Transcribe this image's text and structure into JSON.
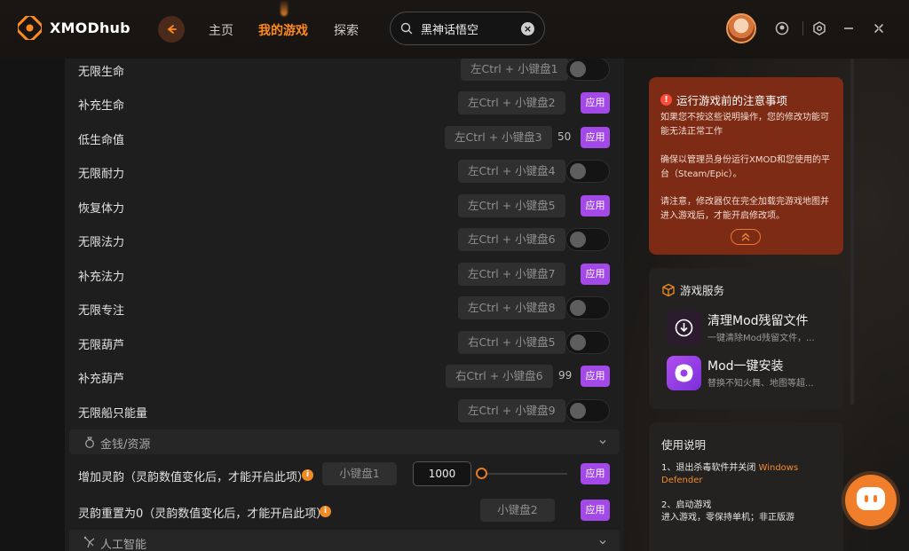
{
  "app": {
    "logo_main": "XMODhub",
    "nav": [
      {
        "label": "主页",
        "active": false
      },
      {
        "label": "我的游戏",
        "active": true
      },
      {
        "label": "探索",
        "active": false
      }
    ],
    "search": {
      "value": "黑神话悟空",
      "clear_glyph": "×"
    }
  },
  "cheats": [
    {
      "label": "无限生命",
      "hotkey": "左Ctrl + 小键盘1",
      "control": "toggle",
      "state": "off"
    },
    {
      "label": "补充生命",
      "hotkey": "左Ctrl + 小键盘2",
      "control": "apply",
      "apply_label": "应用"
    },
    {
      "label": "低生命值",
      "hotkey": "左Ctrl + 小键盘3",
      "value": "50",
      "control": "apply",
      "apply_label": "应用"
    },
    {
      "label": "无限耐力",
      "hotkey": "左Ctrl + 小键盘4",
      "control": "toggle",
      "state": "off"
    },
    {
      "label": "恢复体力",
      "hotkey": "左Ctrl + 小键盘5",
      "control": "apply",
      "apply_label": "应用"
    },
    {
      "label": "无限法力",
      "hotkey": "左Ctrl + 小键盘6",
      "control": "toggle",
      "state": "off"
    },
    {
      "label": "补充法力",
      "hotkey": "左Ctrl + 小键盘7",
      "control": "apply",
      "apply_label": "应用"
    },
    {
      "label": "无限专注",
      "hotkey": "左Ctrl + 小键盘8",
      "control": "toggle",
      "state": "off"
    },
    {
      "label": "无限葫芦",
      "hotkey": "右Ctrl + 小键盘5",
      "control": "toggle",
      "state": "off"
    },
    {
      "label": "补充葫芦",
      "hotkey": "右Ctrl + 小键盘6",
      "value": "99",
      "control": "apply",
      "apply_label": "应用"
    },
    {
      "label": "无限船只能量",
      "hotkey": "左Ctrl + 小键盘9",
      "control": "toggle",
      "state": "off"
    }
  ],
  "section_money": {
    "title": "金钱/资源"
  },
  "money_rows": [
    {
      "label": "增加灵韵（灵韵数值变化后，才能开启此项）",
      "info": "i",
      "hotkey": "小键盘1",
      "input_value": "1000",
      "slider_fraction": 0,
      "apply_label": "应用"
    },
    {
      "label": "灵韵重置为0（灵韵数值变化后，才能开启此项）",
      "info": "i",
      "hotkey": "小键盘2",
      "apply_label": "应用"
    }
  ],
  "section_ai": {
    "title": "人工智能"
  },
  "notice": {
    "icon": "!",
    "title": "运行游戏前的注意事项",
    "p1": "如果您不按这些说明操作，您的修改功能可能无法正常工作",
    "p2": "确保以管理员身份运行XMOD和您使用的平台（Steam/Epic）。",
    "p3": "请注意，修改器仅在完全加载完游戏地图并进入游戏后，才能开启修改项。"
  },
  "services": {
    "title": "游戏服务",
    "items": [
      {
        "name": "清理Mod残留文件",
        "desc": "一键清除Mod残留文件，..."
      },
      {
        "name": "Mod一键安装",
        "desc": "替换不知火舞、地图等超..."
      }
    ]
  },
  "usage": {
    "title": "使用说明",
    "step1_prefix": "1、退出杀毒软件并关闭 ",
    "step1_highlight": "Windows Defender",
    "step2": "2、启动游戏",
    "step2_detail": "进入游戏，零保持单机；非正版游"
  },
  "colors": {
    "accent": "#ff8a1f",
    "apply": "#a349e8",
    "notice_bg": "#7d2b14",
    "chat": "#f07e2a"
  },
  "icons": [
    "back-arrow-icon",
    "search-icon",
    "clear-icon",
    "bell-icon",
    "settings-icon",
    "minimize-icon",
    "close-icon",
    "money-bag-icon",
    "ai-icon",
    "chevron-down-icon",
    "warning-icon",
    "box-icon",
    "download-icon",
    "puzzle-icon",
    "chat-icon"
  ]
}
